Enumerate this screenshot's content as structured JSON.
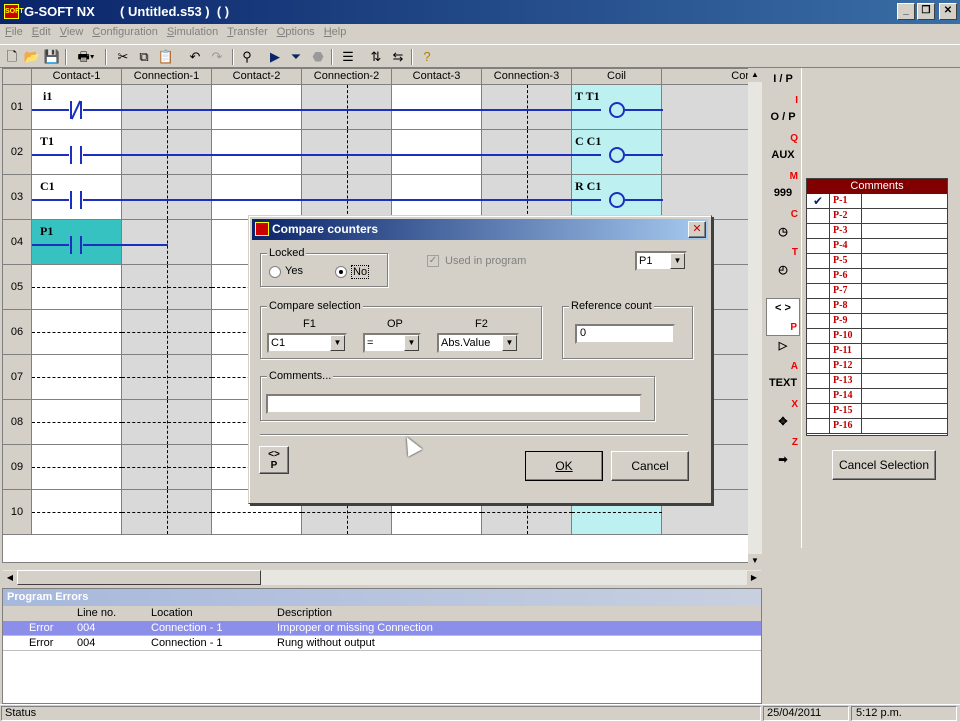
{
  "window": {
    "app_icon": "SOFT",
    "title": "G-SOFT NX       ( Untitled.s53 )  ( )",
    "buttons": [
      "minimize-icon",
      "restore-icon",
      "close-icon"
    ]
  },
  "menu": [
    "File",
    "Edit",
    "View",
    "Configuration",
    "Simulation",
    "Transfer",
    "Options",
    "Help"
  ],
  "toolbar": {
    "icons": [
      "new-icon",
      "open-icon",
      "save-icon",
      "print-icon",
      "cut-icon",
      "copy-icon",
      "paste-icon",
      "undo-icon",
      "redo-icon",
      "find-icon",
      "run-icon",
      "simulate-icon",
      "stop-icon",
      "list-icon",
      "network-icon",
      "transfer-icon",
      "help-icon"
    ]
  },
  "ladder": {
    "columns": [
      "Contact-1",
      "Connection-1",
      "Contact-2",
      "Connection-2",
      "Contact-3",
      "Connection-3",
      "Coil",
      "Cor"
    ],
    "rows": [
      "01",
      "02",
      "03",
      "04",
      "05",
      "06",
      "07",
      "08",
      "09",
      "10"
    ],
    "rungs": [
      {
        "contact": "i1",
        "coil_type": "T",
        "coil_label": "T1"
      },
      {
        "contact": "T1",
        "coil_type": "C",
        "coil_label": "C1"
      },
      {
        "contact": "C1",
        "coil_type": "R",
        "coil_label": "C1"
      },
      {
        "contact": "P1",
        "coil_type": "",
        "coil_label": ""
      }
    ]
  },
  "icon_strip": [
    {
      "name": "input-output-icon",
      "label": "I / P",
      "sub": "I"
    },
    {
      "name": "output-icon",
      "label": "O / P",
      "sub": "Q"
    },
    {
      "name": "aux-icon",
      "label": "AUX",
      "sub": "M"
    },
    {
      "name": "counter-icon",
      "label": "999",
      "sub": "C"
    },
    {
      "name": "timer-icon",
      "label": "◷",
      "sub": "T"
    },
    {
      "name": "clock-icon",
      "label": "◴",
      "sub": ""
    },
    {
      "name": "compare-icon",
      "label": "< >",
      "sub": "P"
    },
    {
      "name": "analog-icon",
      "label": "▷",
      "sub": "A"
    },
    {
      "name": "text-icon",
      "label": "TEXT",
      "sub": "X"
    },
    {
      "name": "move-icon",
      "label": "✥",
      "sub": "Z"
    },
    {
      "name": "arrow-right-icon",
      "label": "➡",
      "sub": ""
    }
  ],
  "comments_panel": {
    "title": "Comments",
    "items": [
      "P-1",
      "P-2",
      "P-3",
      "P-4",
      "P-5",
      "P-6",
      "P-7",
      "P-8",
      "P-9",
      "P-10",
      "P-11",
      "P-12",
      "P-13",
      "P-14",
      "P-15",
      "P-16"
    ],
    "checked_item": "P-1",
    "checkmark": "✔",
    "cancel_button": "Cancel Selection"
  },
  "errors": {
    "title": "Program Errors",
    "headers": [
      "Line no.",
      "Location",
      "Description"
    ],
    "rows": [
      {
        "type": "Error",
        "line": "004",
        "location": "Connection - 1",
        "description": "Improper or missing Connection"
      },
      {
        "type": "Error",
        "line": "004",
        "location": "Connection - 1",
        "description": "Rung without output"
      }
    ]
  },
  "status": {
    "label": "Status",
    "date": "25/04/2011",
    "time": "5:12 p.m."
  },
  "dialog": {
    "title": "Compare counters",
    "locked_label": "Locked",
    "yes_label": "Yes",
    "no_label": "No",
    "locked_value": "No",
    "used_in_program": "Used in program",
    "counter_select": "P1",
    "compare_label": "Compare selection",
    "f1_label": "F1",
    "op_label": "OP",
    "f2_label": "F2",
    "f1_value": "C1",
    "op_value": "=",
    "f2_value": "Abs.Value",
    "reference_label": "Reference count",
    "reference_value": "0",
    "comments_label": "Comments...",
    "comments_value": "",
    "icon_label": "P",
    "ok_label": "OK",
    "cancel_label": "Cancel"
  }
}
